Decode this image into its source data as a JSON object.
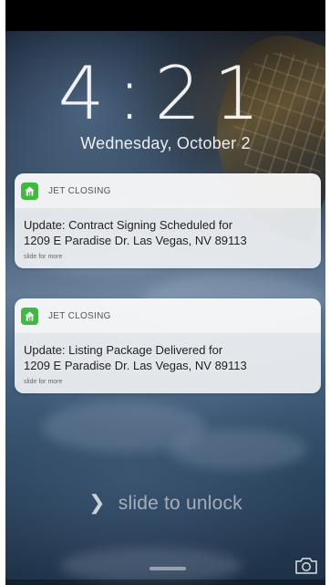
{
  "lockscreen": {
    "time": "4:21",
    "date": "Wednesday, October 2",
    "unlock_text": "slide to unlock"
  },
  "notifications": [
    {
      "app_name": "JET CLOSING",
      "title": "Update: Contract Signing Scheduled for",
      "address": "1209 E Paradise Dr. Las Vegas, NV 89113",
      "more": "slide for more"
    },
    {
      "app_name": "JET CLOSING",
      "title": "Update: Listing Package Delivered for",
      "address": "1209 E Paradise Dr. Las Vegas, NV 89113",
      "more": "slide for more"
    }
  ],
  "icons": {
    "app_icon": "house-icon",
    "unlock_arrow": "chevron-right-icon",
    "camera": "camera-icon"
  },
  "colors": {
    "app_icon_bg": "#3dbb3d",
    "notification_bg": "#eef0f2"
  }
}
